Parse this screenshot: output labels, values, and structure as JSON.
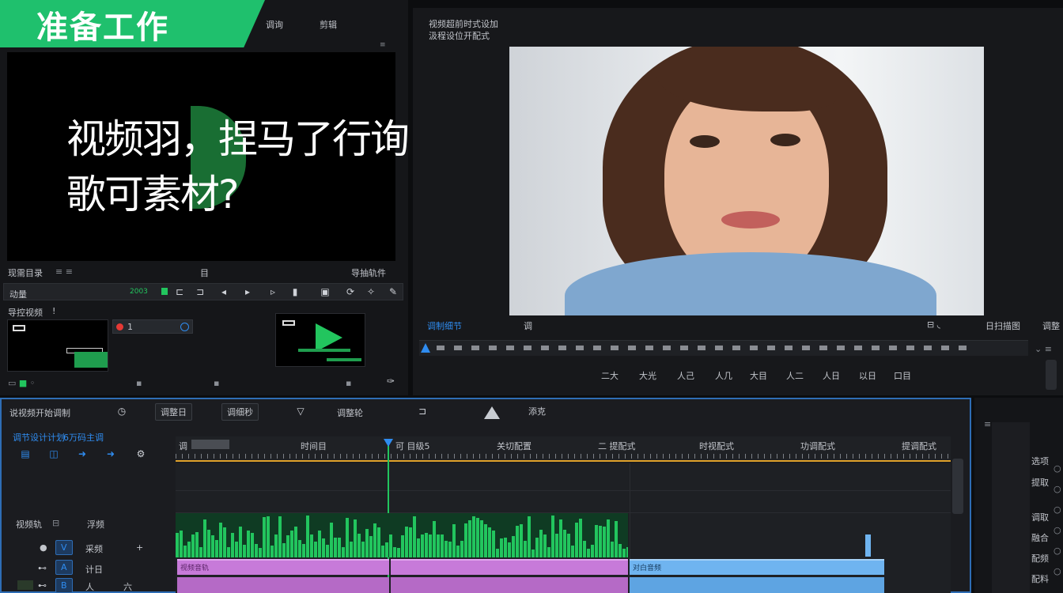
{
  "colors": {
    "accent_green": "#22c55e",
    "accent_blue": "#2f8cf0",
    "audio_pink": "#c77ad9",
    "audio_blue": "#6fb4f0"
  },
  "banner": {
    "title": "准备工作"
  },
  "source_panel": {
    "tabs": [
      "调询",
      "剪辑"
    ],
    "overlay_text_line1": "视频羽，捏马了行询",
    "overlay_text_line2": "歌可素材?",
    "status_left": "现需目录",
    "status_mid": "目",
    "status_right": "导抽轨件",
    "counter_left": "动量",
    "counter_green": "2003",
    "lower_label": "导控视频",
    "lower_mark": "!",
    "clip1_time": "1"
  },
  "program_panel": {
    "title_line1": "视频超前时式设加",
    "title_line2": "汲程设位开配式",
    "label_left": "调制细节",
    "label_mid": "调",
    "label_right": "日扫描图",
    "label_far_right": "调整",
    "ruler_labels": [
      "二大",
      "大光",
      "人己",
      "人几",
      "大目",
      "人二",
      "人日",
      "以日",
      "口目"
    ]
  },
  "timeline": {
    "tabs": [
      "说视频开始调制",
      "调整日",
      "调细秒",
      "调整轮",
      "添克"
    ],
    "sequence_name": "调节设计计划",
    "sequence_code": "6万码主调",
    "ruler_marks": [
      "调",
      "时间目",
      "可 目级5",
      "关切配置",
      "二 提配式",
      "时视配式",
      "功调配式",
      "提调配式"
    ],
    "track_names": [
      "视频轨",
      "浮频",
      "采频",
      "计日"
    ],
    "track_ids": [
      "V",
      "A",
      "B"
    ],
    "track_mini": [
      "+",
      "人",
      "六"
    ],
    "clip_pink_label": "视频音轨",
    "clip_blue_label": "对白音频"
  },
  "right_panel": {
    "items": [
      "选项",
      "提取",
      "调取",
      "融合",
      "配频",
      "配料"
    ]
  },
  "icons": {
    "save": "save-icon",
    "export": "export-icon",
    "forward": "arrow-right-icon",
    "settings": "gear-icon",
    "play": "play-icon"
  }
}
